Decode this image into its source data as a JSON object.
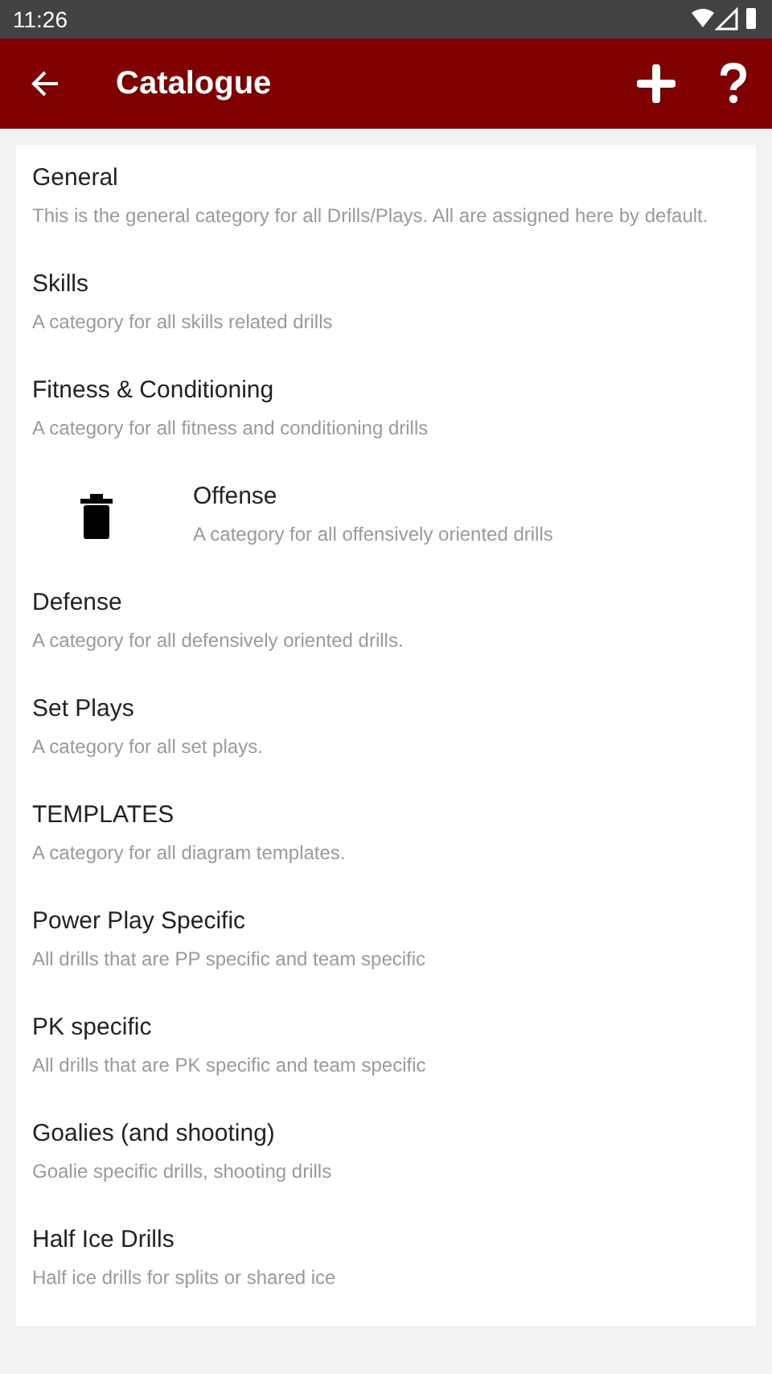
{
  "status_bar": {
    "time": "11:26"
  },
  "app_bar": {
    "title": "Catalogue"
  },
  "categories": [
    {
      "name": "General",
      "description": "This is the general category for all Drills/Plays. All are assigned here by default.",
      "swiped": false
    },
    {
      "name": "Skills",
      "description": "A category for all skills related drills",
      "swiped": false
    },
    {
      "name": "Fitness & Conditioning",
      "description": "A category for all fitness and conditioning drills",
      "swiped": false
    },
    {
      "name": "Offense",
      "description": "A category for all offensively oriented drills",
      "swiped": true
    },
    {
      "name": "Defense",
      "description": "A category for all defensively oriented drills.",
      "swiped": false
    },
    {
      "name": "Set Plays",
      "description": "A category for all set plays.",
      "swiped": false
    },
    {
      "name": "TEMPLATES",
      "description": "A category for all diagram templates.",
      "swiped": false
    },
    {
      "name": "Power Play Specific",
      "description": "All drills that are PP specific and team specific",
      "swiped": false
    },
    {
      "name": "PK specific",
      "description": "All drills that are PK specific and team specific",
      "swiped": false
    },
    {
      "name": "Goalies (and shooting)",
      "description": "Goalie specific drills, shooting drills",
      "swiped": false
    },
    {
      "name": "Half Ice Drills",
      "description": "Half ice drills for splits or shared ice",
      "swiped": false
    }
  ]
}
